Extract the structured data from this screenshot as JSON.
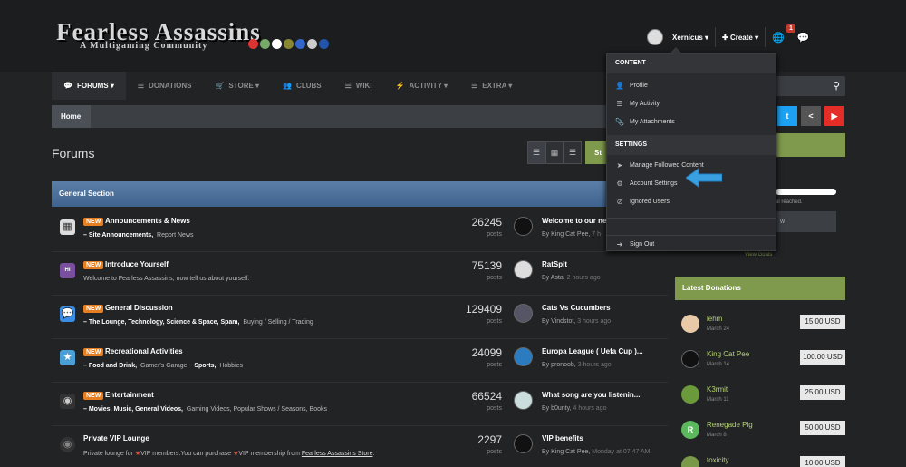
{
  "header": {
    "logo_main": "Fearless Assassins",
    "logo_sub": "A Multigaming Community",
    "username": "Xernicus ▾",
    "create_label": "✚ Create ▾",
    "notification_count": "1"
  },
  "nav": {
    "items": [
      {
        "label": "Forums ▾",
        "icon": "💬"
      },
      {
        "label": "Donations",
        "icon": "☰"
      },
      {
        "label": "Store ▾",
        "icon": "🛒"
      },
      {
        "label": "Clubs",
        "icon": "👥"
      },
      {
        "label": "Wiki",
        "icon": "☰"
      },
      {
        "label": "Activity ▾",
        "icon": "⚡"
      },
      {
        "label": "Extra ▾",
        "icon": "☰"
      }
    ]
  },
  "breadcrumb": {
    "home": "Home"
  },
  "page": {
    "title": "Forums",
    "start_button": "St"
  },
  "section": {
    "title": "General Section"
  },
  "forums": [
    {
      "title": "Announcements & News",
      "new_badge": "NEW",
      "sub_bold": "–   Site Announcements,",
      "sub_plain": "Report News",
      "count": "26245",
      "posts": "posts",
      "last_title": "Welcome to our ne",
      "last_by": "By King Cat Pee,",
      "last_time": "7 h"
    },
    {
      "title": "Introduce Yourself",
      "new_badge": "NEW",
      "sub_plain": "Welcome to Fearless Assassins, now tell us about yourself.",
      "count": "75139",
      "posts": "posts",
      "last_title": "RatSpit",
      "last_by": "By Asta,",
      "last_time": "2 hours ago"
    },
    {
      "title": "General Discussion",
      "new_badge": "NEW",
      "sub_bold": "–   The Lounge,    Technology,    Science & Space,    Spam,",
      "sub_plain": "Buying / Selling / Trading",
      "count": "129409",
      "posts": "posts",
      "last_title": "Cats Vs Cucumbers",
      "last_by": "By Vindstot,",
      "last_time": "3 hours ago"
    },
    {
      "title": "Recreational Activities",
      "new_badge": "NEW",
      "sub_bold": "–   Food and Drink,",
      "sub_mid": "Gamer's Garage,",
      "sub_bold2": "Sports,",
      "sub_plain": "Hobbies",
      "count": "24099",
      "posts": "posts",
      "last_title": "Europa League ( Uefa Cup )...",
      "last_by": "By pronoob,",
      "last_time": "3 hours ago"
    },
    {
      "title": "Entertainment",
      "new_badge": "NEW",
      "sub_bold": "–   Movies,    Music,    General Videos,",
      "sub_plain": "Gaming Videos,    Popular Shows / Seasons,    Books",
      "count": "66524",
      "posts": "posts",
      "last_title": "What song are you listenin...",
      "last_by": "By b0unty,",
      "last_time": "4 hours ago"
    },
    {
      "title": "Private VIP Lounge",
      "sub_a": "Private lounge for",
      "sub_vip1": "★",
      "sub_b": "VIP members.You can purchase",
      "sub_vip2": "★",
      "sub_c": "VIP membership from",
      "sub_link": "Fearless Assassins Store",
      "sub_end": ".",
      "count": "2297",
      "posts": "posts",
      "last_title": "VIP benefits",
      "last_by": "By King Cat Pee,",
      "last_time": "Monday at 07:47 AM"
    }
  ],
  "dropdown": {
    "content_head": "Content",
    "profile": "Profile",
    "my_activity": "My Activity",
    "my_attachments": "My Attachments",
    "settings_head": "Settings",
    "manage_followed": "Manage Followed Content",
    "account_settings": "Account Settings",
    "ignored_users": "Ignored Users",
    "sign_out": "Sign Out"
  },
  "sidebar": {
    "goal_text": "al reached.",
    "goal_button": "w",
    "view_goals": "View Goals",
    "donations_title": "Latest Donations",
    "donations": [
      {
        "name": "lehm",
        "date": "March 24",
        "amount": "15.00 USD"
      },
      {
        "name": "King Cat Pee",
        "date": "March 14",
        "amount": "100.00 USD"
      },
      {
        "name": "K3rmit",
        "date": "March 11",
        "amount": "25.00 USD"
      },
      {
        "name": "Renegade Pig",
        "date": "March 8",
        "amount": "50.00 USD",
        "initial": "R"
      },
      {
        "name": "toxicity",
        "date": "",
        "amount": "10.00 USD"
      }
    ]
  },
  "colors": {
    "accent_green": "#7f9a4d",
    "section_blue": "#4f73a0",
    "new_badge": "#e67e22",
    "twitter": "#1da1f2",
    "youtube": "#e52d27"
  }
}
